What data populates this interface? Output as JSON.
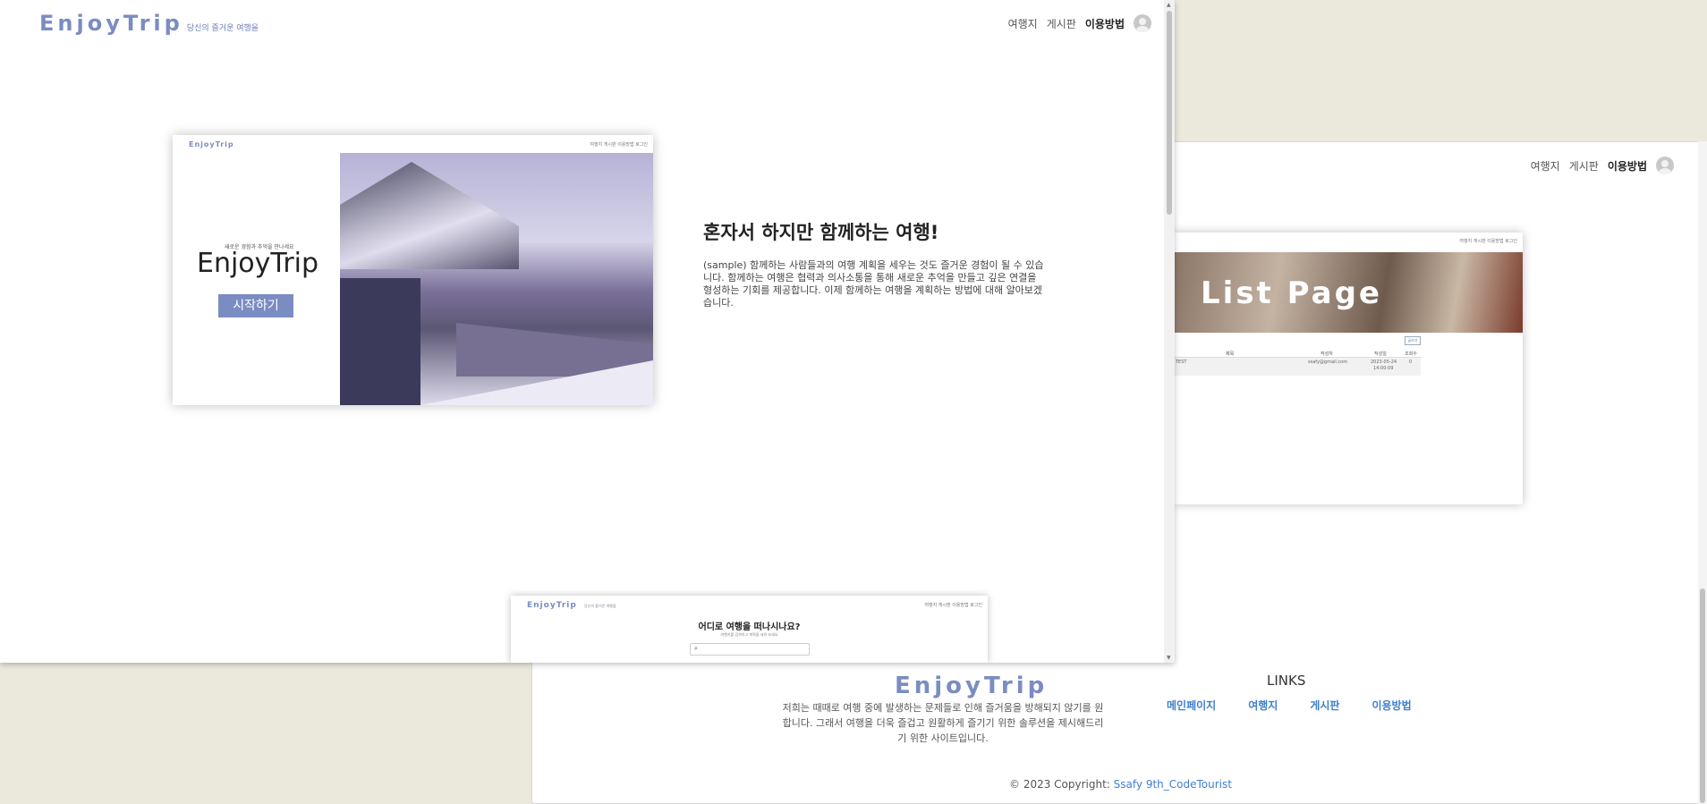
{
  "brand": {
    "logo": "EnjoyTrip",
    "tagline": "당신의 즐거운 여행을"
  },
  "nav": {
    "items": [
      "여행지",
      "게시판",
      "이용방법"
    ]
  },
  "hero": {
    "mini_nav": "여행지 게시판 이용방법 로그인",
    "subtitle": "새로운 경험과 추억을 만나세요",
    "title": "EnjoyTrip",
    "start_button": "시작하기"
  },
  "intro": {
    "title": "혼자서 하지만 함께하는 여행!",
    "text": "(sample) 함께하는 사람들과의 여행 계획을 세우는 것도 즐거운 경험이 될 수 있습니다. 함께하는 여행은 협력과 의사소통을 통해 새로운 추억을 만들고 깊은 연결을 형성하는 기회를 제공합니다. 이제 함께하는 여행을 계획하는 방법에 대해 알아보겠습니다."
  },
  "search_preview": {
    "question": "어디로 여행을 떠나시나요?",
    "hint": "여행지를 검색하고 계획을 세워 보세요"
  },
  "list_preview": {
    "banner": "List Page",
    "mini_nav": "여행지 게시판 이용방법 로그인",
    "write_button": "글쓰기",
    "headers": [
      "제목",
      "작성자",
      "작성일",
      "조회수"
    ],
    "row": {
      "title": "TEST",
      "author": "ssafy@gmail.com",
      "date": "2023-05-24",
      "time": "14:00:09",
      "views": "0"
    }
  },
  "footer": {
    "logo": "EnjoyTrip",
    "description": "저희는 때때로 여행 중에 발생하는 문제들로 인해 즐거움을 방해되지 않기를 원합니다. 그래서 여행을 더욱 즐겁고 원활하게 즐기기 위한 솔루션을 제시해드리기 위한 사이트입니다.",
    "links_title": "LINKS",
    "links": [
      "메인페이지",
      "여행지",
      "게시판",
      "이용방법"
    ],
    "copyright_prefix": "© 2023 Copyright: ",
    "copyright_link": "Ssafy 9th_CodeTourist"
  },
  "colors": {
    "accent": "#7a8cc2",
    "link": "#3f7fcf"
  }
}
